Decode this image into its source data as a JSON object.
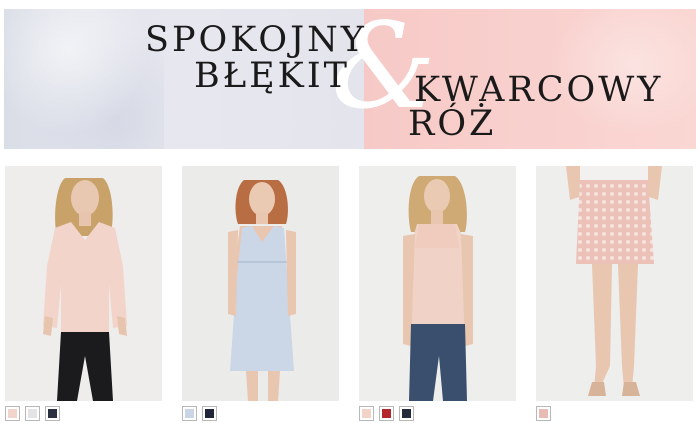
{
  "banner": {
    "line1": "SPOKOJNY",
    "line2": "BŁĘKIT",
    "ampersand": "&",
    "line3": "KWARCOWY",
    "line4": "RÓŻ"
  },
  "products": [
    {
      "name": "product-blouse",
      "swatches": [
        "#f1d5cc",
        "#e3e3e6",
        "#2c3142"
      ]
    },
    {
      "name": "product-dress",
      "swatches": [
        "#cad6e6",
        "#20253a"
      ]
    },
    {
      "name": "product-top",
      "swatches": [
        "#f2d3c7",
        "#b4262b",
        "#222a3c"
      ]
    },
    {
      "name": "product-skirt",
      "swatches": [
        "#e8bcb4"
      ]
    }
  ]
}
